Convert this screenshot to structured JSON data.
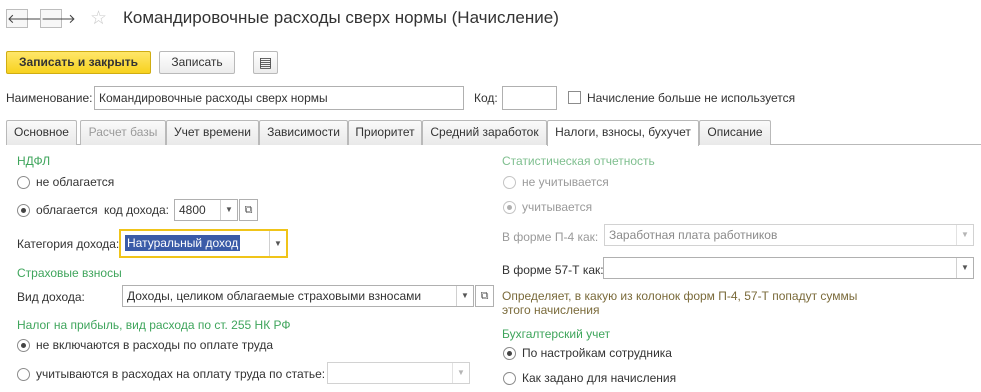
{
  "header": {
    "back_glyph": "🡐",
    "forward_glyph": "🡒",
    "star_glyph": "☆",
    "title": "Командировочные расходы сверх нормы (Начисление)"
  },
  "toolbar": {
    "save_close_label": "Записать и закрыть",
    "save_label": "Записать",
    "report_glyph": "▤"
  },
  "form": {
    "name_label": "Наименование:",
    "name_value": "Командировочные расходы сверх нормы",
    "code_label": "Код:",
    "code_value": "",
    "unused_label": "Начисление больше не используется",
    "unused_checked": false
  },
  "tabs": [
    {
      "label": "Основное",
      "disabled": false,
      "active": false
    },
    {
      "label": "Расчет базы",
      "disabled": true,
      "active": false
    },
    {
      "label": "Учет времени",
      "disabled": false,
      "active": false
    },
    {
      "label": "Зависимости",
      "disabled": false,
      "active": false
    },
    {
      "label": "Приоритет",
      "disabled": false,
      "active": false
    },
    {
      "label": "Средний заработок",
      "disabled": false,
      "active": false
    },
    {
      "label": "Налоги, взносы, бухучет",
      "disabled": false,
      "active": true
    },
    {
      "label": "Описание",
      "disabled": false,
      "active": false
    }
  ],
  "ndfl": {
    "section_title": "НДФЛ",
    "not_taxed_label": "не облагается",
    "taxed_label": "облагается",
    "selected": "taxed",
    "income_code_label": "код дохода:",
    "income_code_value": "4800",
    "income_category_label": "Категория дохода:",
    "income_category_value": "Натуральный доход"
  },
  "insurance": {
    "section_title": "Страховые взносы",
    "income_type_label": "Вид дохода:",
    "income_type_value": "Доходы, целиком облагаемые страховыми взносами"
  },
  "profit_tax": {
    "section_title": "Налог на прибыль, вид расхода по ст. 255 НК РФ",
    "not_included_label": "не включаются в расходы по оплате труда",
    "included_label": "учитываются в расходах на оплату труда по статье:",
    "selected": "not_included",
    "article_value": ""
  },
  "stats": {
    "section_title": "Статистическая отчетность",
    "not_counted_label": "не учитывается",
    "counted_label": "учитывается",
    "selected": "counted",
    "p4_label": "В форме П-4 как:",
    "p4_value": "Заработная плата работников",
    "f57_label": "В форме 57-Т как:",
    "f57_value": "",
    "hint_line1": "Определяет, в какую из колонок форм П-4, 57-Т попадут суммы",
    "hint_line2": "этого начисления"
  },
  "accounting": {
    "section_title": "Бухгалтерский учет",
    "by_employee_label": "По настройкам сотрудника",
    "as_set_label": "Как задано для начисления",
    "selected": "by_employee"
  },
  "colors": {
    "accent_yellow": "#f7d21e",
    "section_green": "#3fa55c",
    "focus_border": "#f0c419",
    "selection_bg": "#3a5ba8"
  }
}
